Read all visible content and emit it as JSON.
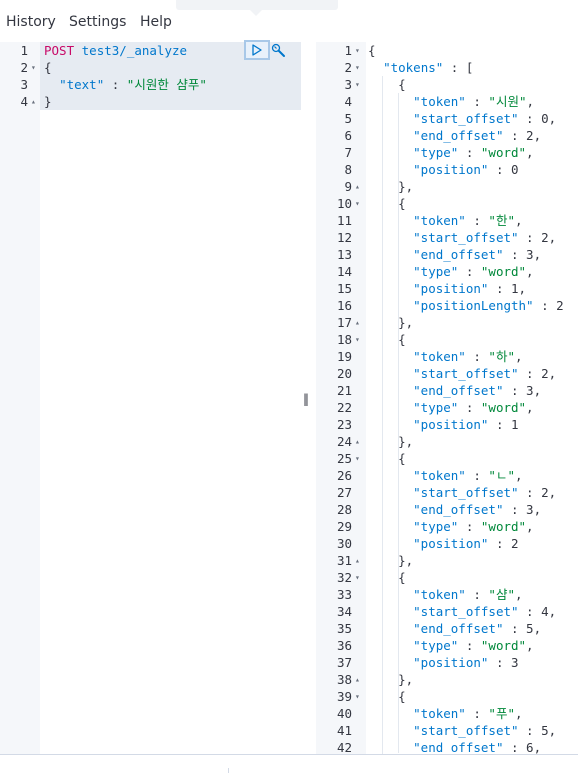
{
  "menu": {
    "history": "History",
    "settings": "Settings",
    "help": "Help"
  },
  "request": {
    "method": "POST",
    "index": "test3",
    "cursor_sep": "/",
    "endpoint": "_analyze",
    "open_brace": "{",
    "key": "\"text\"",
    "colon": " : ",
    "value": "\"시원한 샴푸\"",
    "close_brace": "}"
  },
  "toolbar": {
    "run_icon": "play-icon",
    "wrench_icon": "wrench-icon"
  },
  "resizer": {
    "handle": "‖"
  },
  "response_lines": [
    {
      "n": "1",
      "fold": "▾",
      "text": "{"
    },
    {
      "n": "2",
      "fold": "▾",
      "text": "  \"tokens\" : ["
    },
    {
      "n": "3",
      "fold": "▾",
      "text": "    {"
    },
    {
      "n": "4",
      "fold": "",
      "text": "      \"token\" : \"시원\","
    },
    {
      "n": "5",
      "fold": "",
      "text": "      \"start_offset\" : 0,"
    },
    {
      "n": "6",
      "fold": "",
      "text": "      \"end_offset\" : 2,"
    },
    {
      "n": "7",
      "fold": "",
      "text": "      \"type\" : \"word\","
    },
    {
      "n": "8",
      "fold": "",
      "text": "      \"position\" : 0"
    },
    {
      "n": "9",
      "fold": "▴",
      "text": "    },"
    },
    {
      "n": "10",
      "fold": "▾",
      "text": "    {"
    },
    {
      "n": "11",
      "fold": "",
      "text": "      \"token\" : \"한\","
    },
    {
      "n": "12",
      "fold": "",
      "text": "      \"start_offset\" : 2,"
    },
    {
      "n": "13",
      "fold": "",
      "text": "      \"end_offset\" : 3,"
    },
    {
      "n": "14",
      "fold": "",
      "text": "      \"type\" : \"word\","
    },
    {
      "n": "15",
      "fold": "",
      "text": "      \"position\" : 1,"
    },
    {
      "n": "16",
      "fold": "",
      "text": "      \"positionLength\" : 2"
    },
    {
      "n": "17",
      "fold": "▴",
      "text": "    },"
    },
    {
      "n": "18",
      "fold": "▾",
      "text": "    {"
    },
    {
      "n": "19",
      "fold": "",
      "text": "      \"token\" : \"하\","
    },
    {
      "n": "20",
      "fold": "",
      "text": "      \"start_offset\" : 2,"
    },
    {
      "n": "21",
      "fold": "",
      "text": "      \"end_offset\" : 3,"
    },
    {
      "n": "22",
      "fold": "",
      "text": "      \"type\" : \"word\","
    },
    {
      "n": "23",
      "fold": "",
      "text": "      \"position\" : 1"
    },
    {
      "n": "24",
      "fold": "▴",
      "text": "    },"
    },
    {
      "n": "25",
      "fold": "▾",
      "text": "    {"
    },
    {
      "n": "26",
      "fold": "",
      "text": "      \"token\" : \"ㄴ\","
    },
    {
      "n": "27",
      "fold": "",
      "text": "      \"start_offset\" : 2,"
    },
    {
      "n": "28",
      "fold": "",
      "text": "      \"end_offset\" : 3,"
    },
    {
      "n": "29",
      "fold": "",
      "text": "      \"type\" : \"word\","
    },
    {
      "n": "30",
      "fold": "",
      "text": "      \"position\" : 2"
    },
    {
      "n": "31",
      "fold": "▴",
      "text": "    },"
    },
    {
      "n": "32",
      "fold": "▾",
      "text": "    {"
    },
    {
      "n": "33",
      "fold": "",
      "text": "      \"token\" : \"샴\","
    },
    {
      "n": "34",
      "fold": "",
      "text": "      \"start_offset\" : 4,"
    },
    {
      "n": "35",
      "fold": "",
      "text": "      \"end_offset\" : 5,"
    },
    {
      "n": "36",
      "fold": "",
      "text": "      \"type\" : \"word\","
    },
    {
      "n": "37",
      "fold": "",
      "text": "      \"position\" : 3"
    },
    {
      "n": "38",
      "fold": "▴",
      "text": "    },"
    },
    {
      "n": "39",
      "fold": "▾",
      "text": "    {"
    },
    {
      "n": "40",
      "fold": "",
      "text": "      \"token\" : \"푸\","
    },
    {
      "n": "41",
      "fold": "",
      "text": "      \"start_offset\" : 5,"
    },
    {
      "n": "42",
      "fold": "",
      "text": "      \"end_offset\" : 6,"
    }
  ]
}
